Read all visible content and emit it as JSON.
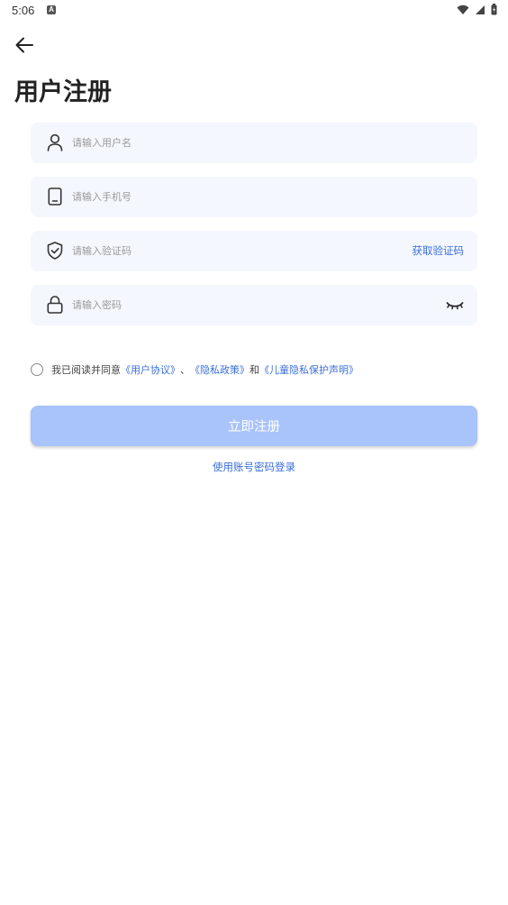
{
  "status_bar": {
    "time": "5:06",
    "notification_icon": "A"
  },
  "page": {
    "title": "用户注册"
  },
  "form": {
    "username": {
      "placeholder": "请输入用户名",
      "value": "",
      "icon": "user-icon"
    },
    "phone": {
      "placeholder": "请输入手机号",
      "value": "",
      "icon": "phone-icon"
    },
    "code": {
      "placeholder": "请输入验证码",
      "value": "",
      "icon": "shield-icon",
      "get_code_label": "获取验证码"
    },
    "password": {
      "placeholder": "请输入密码",
      "value": "",
      "icon": "lock-icon",
      "toggle_icon": "eye-closed-icon"
    }
  },
  "agreement": {
    "prefix": "我已阅读并同意",
    "user_agreement": "《用户协议》",
    "separator": "、",
    "privacy_policy": "《隐私政策》",
    "and": "和",
    "children_privacy": "《儿童隐私保护声明》",
    "checked": false
  },
  "actions": {
    "register_label": "立即注册",
    "login_link": "使用账号密码登录"
  },
  "colors": {
    "accent": "#3a6fd8",
    "button_disabled": "#a9c3fb",
    "field_bg": "#f4f7fd"
  }
}
